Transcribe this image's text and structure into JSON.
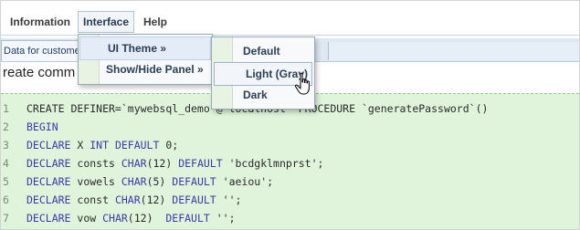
{
  "menubar": {
    "items": [
      {
        "label": "Information"
      },
      {
        "label": "Interface"
      },
      {
        "label": "Help"
      }
    ]
  },
  "tab": {
    "label": "Data for customer"
  },
  "heading": "reate comm",
  "interface_menu": {
    "items": [
      {
        "label": "UI Theme »"
      },
      {
        "label": "Show/Hide Panel »"
      }
    ]
  },
  "theme_menu": {
    "items": [
      {
        "label": "Default"
      },
      {
        "label": "Light (Gray)"
      },
      {
        "label": "Dark"
      }
    ],
    "hovered": "Light (Gray)"
  },
  "code": {
    "lines": [
      {
        "n": "1",
        "segments": [
          {
            "t": "CREATE DEFINER=`mywebsql_demo`@`localhost` PROCEDURE `generatePassword`()",
            "c": "plain"
          }
        ]
      },
      {
        "n": "2",
        "segments": [
          {
            "t": "BEGIN",
            "c": "kw"
          }
        ]
      },
      {
        "n": "3",
        "segments": [
          {
            "t": "DECLARE",
            "c": "kw"
          },
          {
            "t": " X ",
            "c": "plain"
          },
          {
            "t": "INT DEFAULT",
            "c": "kw"
          },
          {
            "t": " 0;",
            "c": "plain"
          }
        ]
      },
      {
        "n": "4",
        "segments": [
          {
            "t": "DECLARE",
            "c": "kw"
          },
          {
            "t": " consts ",
            "c": "plain"
          },
          {
            "t": "CHAR",
            "c": "kw"
          },
          {
            "t": "(12) ",
            "c": "plain"
          },
          {
            "t": "DEFAULT",
            "c": "kw"
          },
          {
            "t": " 'bcdgklmnprst';",
            "c": "plain"
          }
        ]
      },
      {
        "n": "5",
        "segments": [
          {
            "t": "DECLARE",
            "c": "kw"
          },
          {
            "t": " vowels ",
            "c": "plain"
          },
          {
            "t": "CHAR",
            "c": "kw"
          },
          {
            "t": "(5) ",
            "c": "plain"
          },
          {
            "t": "DEFAULT",
            "c": "kw"
          },
          {
            "t": " 'aeiou';",
            "c": "plain"
          }
        ]
      },
      {
        "n": "6",
        "segments": [
          {
            "t": "DECLARE",
            "c": "kw"
          },
          {
            "t": " const ",
            "c": "plain"
          },
          {
            "t": "CHAR",
            "c": "kw"
          },
          {
            "t": "(12) ",
            "c": "plain"
          },
          {
            "t": "DEFAULT",
            "c": "kw"
          },
          {
            "t": " '';",
            "c": "plain"
          }
        ]
      },
      {
        "n": "7",
        "segments": [
          {
            "t": "DECLARE",
            "c": "kw"
          },
          {
            "t": " vow ",
            "c": "plain"
          },
          {
            "t": "CHAR",
            "c": "kw"
          },
          {
            "t": "(12)  ",
            "c": "plain"
          },
          {
            "t": "DEFAULT",
            "c": "kw"
          },
          {
            "t": " '';",
            "c": "plain"
          }
        ]
      }
    ]
  },
  "icons": {
    "cursor": "hand-pointer-icon"
  },
  "colors": {
    "code_background": "#dff4db",
    "menu_gutter": "#e8f3e3",
    "keyword": "#3a3aa8",
    "menu_text": "#2c3e55"
  }
}
